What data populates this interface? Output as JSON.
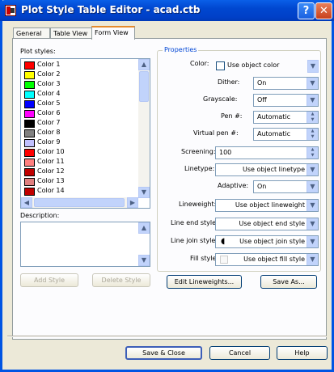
{
  "window": {
    "title": "Plot Style Table Editor - acad.ctb"
  },
  "tabs": [
    {
      "label": "General"
    },
    {
      "label": "Table View"
    },
    {
      "label": "Form View"
    }
  ],
  "plot_styles": {
    "label": "Plot styles:",
    "items": [
      {
        "label": "Color 1",
        "color": "#ff0000"
      },
      {
        "label": "Color 2",
        "color": "#ffff00"
      },
      {
        "label": "Color 3",
        "color": "#00ff00"
      },
      {
        "label": "Color 4",
        "color": "#00ffff"
      },
      {
        "label": "Color 5",
        "color": "#0000ff"
      },
      {
        "label": "Color 6",
        "color": "#ff00ff"
      },
      {
        "label": "Color 7",
        "color": "#000000"
      },
      {
        "label": "Color 8",
        "color": "#808080"
      },
      {
        "label": "Color 9",
        "color": "#c0c0ff"
      },
      {
        "label": "Color 10",
        "color": "#ff0000"
      },
      {
        "label": "Color 11",
        "color": "#ff8080"
      },
      {
        "label": "Color 12",
        "color": "#c00000"
      },
      {
        "label": "Color 13",
        "color": "#e08080"
      },
      {
        "label": "Color 14",
        "color": "#c00000"
      }
    ]
  },
  "description": {
    "label": "Description:"
  },
  "buttons": {
    "add_style": "Add Style",
    "delete_style": "Delete Style",
    "edit_lineweights": "Edit Lineweights...",
    "save_as": "Save As...",
    "save_close": "Save & Close",
    "cancel": "Cancel",
    "help": "Help"
  },
  "properties": {
    "title": "Properties",
    "color_label": "Color:",
    "use_object_color": "Use object color",
    "dither_label": "Dither:",
    "dither_value": "On",
    "grayscale_label": "Grayscale:",
    "grayscale_value": "Off",
    "pen_label": "Pen #:",
    "pen_value": "Automatic",
    "virtual_pen_label": "Virtual pen #:",
    "virtual_pen_value": "Automatic",
    "screening_label": "Screening:",
    "screening_value": "100",
    "linetype_label": "Linetype:",
    "linetype_value": "Use object linetype",
    "adaptive_label": "Adaptive:",
    "adaptive_value": "On",
    "lineweight_label": "Lineweight:",
    "lineweight_value": "Use object lineweight",
    "line_end_label": "Line end style:",
    "line_end_value": "Use object end style",
    "line_join_label": "Line join style:",
    "line_join_value": "Use object join style",
    "fill_label": "Fill style:",
    "fill_value": "Use object fill style"
  },
  "colors": {
    "titlebar": "#0054e3",
    "accent_tab": "#e68b2c"
  }
}
